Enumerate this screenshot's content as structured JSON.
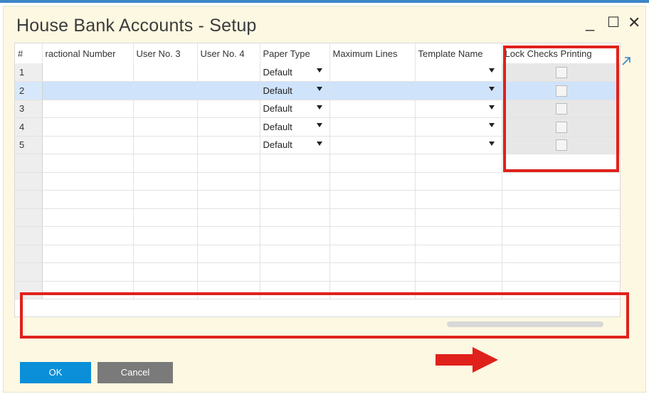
{
  "window": {
    "title": "House Bank Accounts - Setup",
    "minimize": "_",
    "maximize": "☐",
    "close": "✕"
  },
  "grid": {
    "columns": [
      "#",
      "ractional Number",
      "User No. 3",
      "User No. 4",
      "Paper Type",
      "Maximum Lines",
      "Template Name",
      "Lock Checks Printing"
    ],
    "rows": [
      {
        "num": "1",
        "paper_type": "Default",
        "selected": false
      },
      {
        "num": "2",
        "paper_type": "Default",
        "selected": true
      },
      {
        "num": "3",
        "paper_type": "Default",
        "selected": false
      },
      {
        "num": "4",
        "paper_type": "Default",
        "selected": false
      },
      {
        "num": "5",
        "paper_type": "Default",
        "selected": false
      }
    ],
    "empty_rows": 8
  },
  "icons": {
    "expand": "expand-arrow-icon",
    "dropdown": "dropdown-arrow-icon",
    "checkbox": "checkbox-icon"
  },
  "colors": {
    "accent": "#0a8fd8",
    "highlight": "#e0211b",
    "selected_row": "#cfe3fb",
    "window_bg": "#fdf8e2"
  },
  "buttons": {
    "ok": "OK",
    "cancel": "Cancel"
  }
}
